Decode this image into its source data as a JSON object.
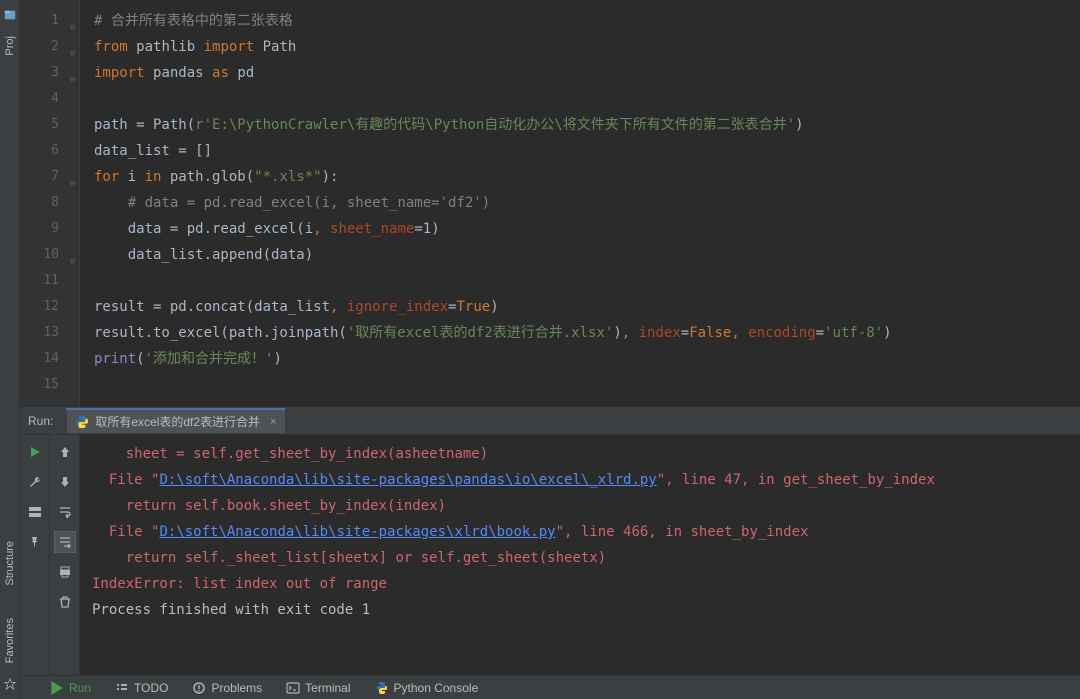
{
  "sidebars": {
    "project_label": "Proj",
    "structure_label": "Structure",
    "favorites_label": "Favorites"
  },
  "editor": {
    "lines": [
      {
        "n": "1",
        "fold": "⊖",
        "spans": [
          [
            "c-comment",
            "# 合并所有表格中的第二张表格"
          ]
        ]
      },
      {
        "n": "2",
        "fold": "⊖",
        "spans": [
          [
            "c-keyword",
            "from "
          ],
          [
            "c-default",
            "pathlib "
          ],
          [
            "c-keyword",
            "import "
          ],
          [
            "c-default",
            "Path"
          ]
        ]
      },
      {
        "n": "3",
        "fold": "⊖",
        "spans": [
          [
            "c-keyword",
            "import "
          ],
          [
            "c-default",
            "pandas "
          ],
          [
            "c-keyword",
            "as "
          ],
          [
            "c-default",
            "pd"
          ]
        ]
      },
      {
        "n": "4",
        "spans": []
      },
      {
        "n": "5",
        "spans": [
          [
            "c-default",
            "path = Path("
          ],
          [
            "c-string",
            "r'E:\\PythonCrawler\\有趣的代码\\Python自动化办公\\将文件夹下所有文件的第二张表合并'"
          ],
          [
            "c-default",
            ")"
          ]
        ]
      },
      {
        "n": "6",
        "spans": [
          [
            "c-default",
            "data_list = []"
          ]
        ]
      },
      {
        "n": "7",
        "fold": "⊖",
        "spans": [
          [
            "c-keyword",
            "for "
          ],
          [
            "c-default",
            "i "
          ],
          [
            "c-keyword",
            "in "
          ],
          [
            "c-default",
            "path.glob("
          ],
          [
            "c-string",
            "\"*.xls*\""
          ],
          [
            "c-default",
            "):"
          ]
        ]
      },
      {
        "n": "8",
        "indent": 1,
        "spans": [
          [
            "c-comment",
            "# data = pd.read_excel(i, sheet_name='df2')"
          ]
        ]
      },
      {
        "n": "9",
        "indent": 1,
        "spans": [
          [
            "c-default",
            "data = pd.read_excel(i"
          ],
          [
            "c-keyword",
            ", "
          ],
          [
            "c-param",
            "sheet_name"
          ],
          [
            "c-default",
            "="
          ],
          [
            "c-default",
            "1"
          ],
          [
            "c-default",
            ")"
          ]
        ]
      },
      {
        "n": "10",
        "fold": "⊖",
        "indent": 1,
        "spans": [
          [
            "c-default",
            "data_list.append(data)"
          ]
        ]
      },
      {
        "n": "11",
        "spans": []
      },
      {
        "n": "12",
        "spans": [
          [
            "c-default",
            "result = pd.concat(data_list"
          ],
          [
            "c-keyword",
            ", "
          ],
          [
            "c-param",
            "ignore_index"
          ],
          [
            "c-default",
            "="
          ],
          [
            "c-keyword",
            "True"
          ],
          [
            "c-default",
            ")"
          ]
        ]
      },
      {
        "n": "13",
        "spans": [
          [
            "c-default",
            "result.to_excel(path.joinpath("
          ],
          [
            "c-string",
            "'取所有excel表的df2表进行合并.xlsx'"
          ],
          [
            "c-default",
            ")"
          ],
          [
            "c-keyword",
            ", "
          ],
          [
            "c-param",
            "index"
          ],
          [
            "c-default",
            "="
          ],
          [
            "c-keyword",
            "False"
          ],
          [
            "c-keyword",
            ", "
          ],
          [
            "c-param",
            "encoding"
          ],
          [
            "c-default",
            "="
          ],
          [
            "c-string",
            "'utf-8'"
          ],
          [
            "c-default",
            ")"
          ]
        ]
      },
      {
        "n": "14",
        "spans": [
          [
            "c-builtin",
            "print"
          ],
          [
            "c-default",
            "("
          ],
          [
            "c-string",
            "'添加和合并完成！'"
          ],
          [
            "c-default",
            ")"
          ]
        ]
      },
      {
        "n": "15",
        "spans": []
      }
    ]
  },
  "run": {
    "label": "Run:",
    "tab_name": "取所有excel表的df2表进行合并",
    "close_x": "×",
    "console_lines": [
      {
        "indent": 2,
        "parts": [
          [
            "err",
            "sheet = self.get_sheet_by_index(asheetname)"
          ]
        ]
      },
      {
        "indent": 1,
        "parts": [
          [
            "err",
            "File \""
          ],
          [
            "err-link",
            "D:\\soft\\Anaconda\\lib\\site-packages\\pandas\\io\\excel\\_xlrd.py"
          ],
          [
            "err",
            "\", line 47, in get_sheet_by_index"
          ]
        ]
      },
      {
        "indent": 2,
        "parts": [
          [
            "err",
            "return self.book.sheet_by_index(index)"
          ]
        ]
      },
      {
        "indent": 1,
        "parts": [
          [
            "err",
            "File \""
          ],
          [
            "err-link",
            "D:\\soft\\Anaconda\\lib\\site-packages\\xlrd\\book.py"
          ],
          [
            "err",
            "\", line 466, in sheet_by_index"
          ]
        ]
      },
      {
        "indent": 2,
        "parts": [
          [
            "err",
            "return self._sheet_list[sheetx] or self.get_sheet(sheetx)"
          ]
        ]
      },
      {
        "indent": 0,
        "parts": [
          [
            "err",
            "IndexError: list index out of range"
          ]
        ]
      },
      {
        "indent": 0,
        "parts": [
          [
            "normal-out",
            ""
          ]
        ]
      },
      {
        "indent": 0,
        "parts": [
          [
            "normal-out",
            "Process finished with exit code 1"
          ]
        ]
      }
    ]
  },
  "bottom": {
    "run": "Run",
    "todo": "TODO",
    "problems": "Problems",
    "terminal": "Terminal",
    "python_console": "Python Console"
  }
}
